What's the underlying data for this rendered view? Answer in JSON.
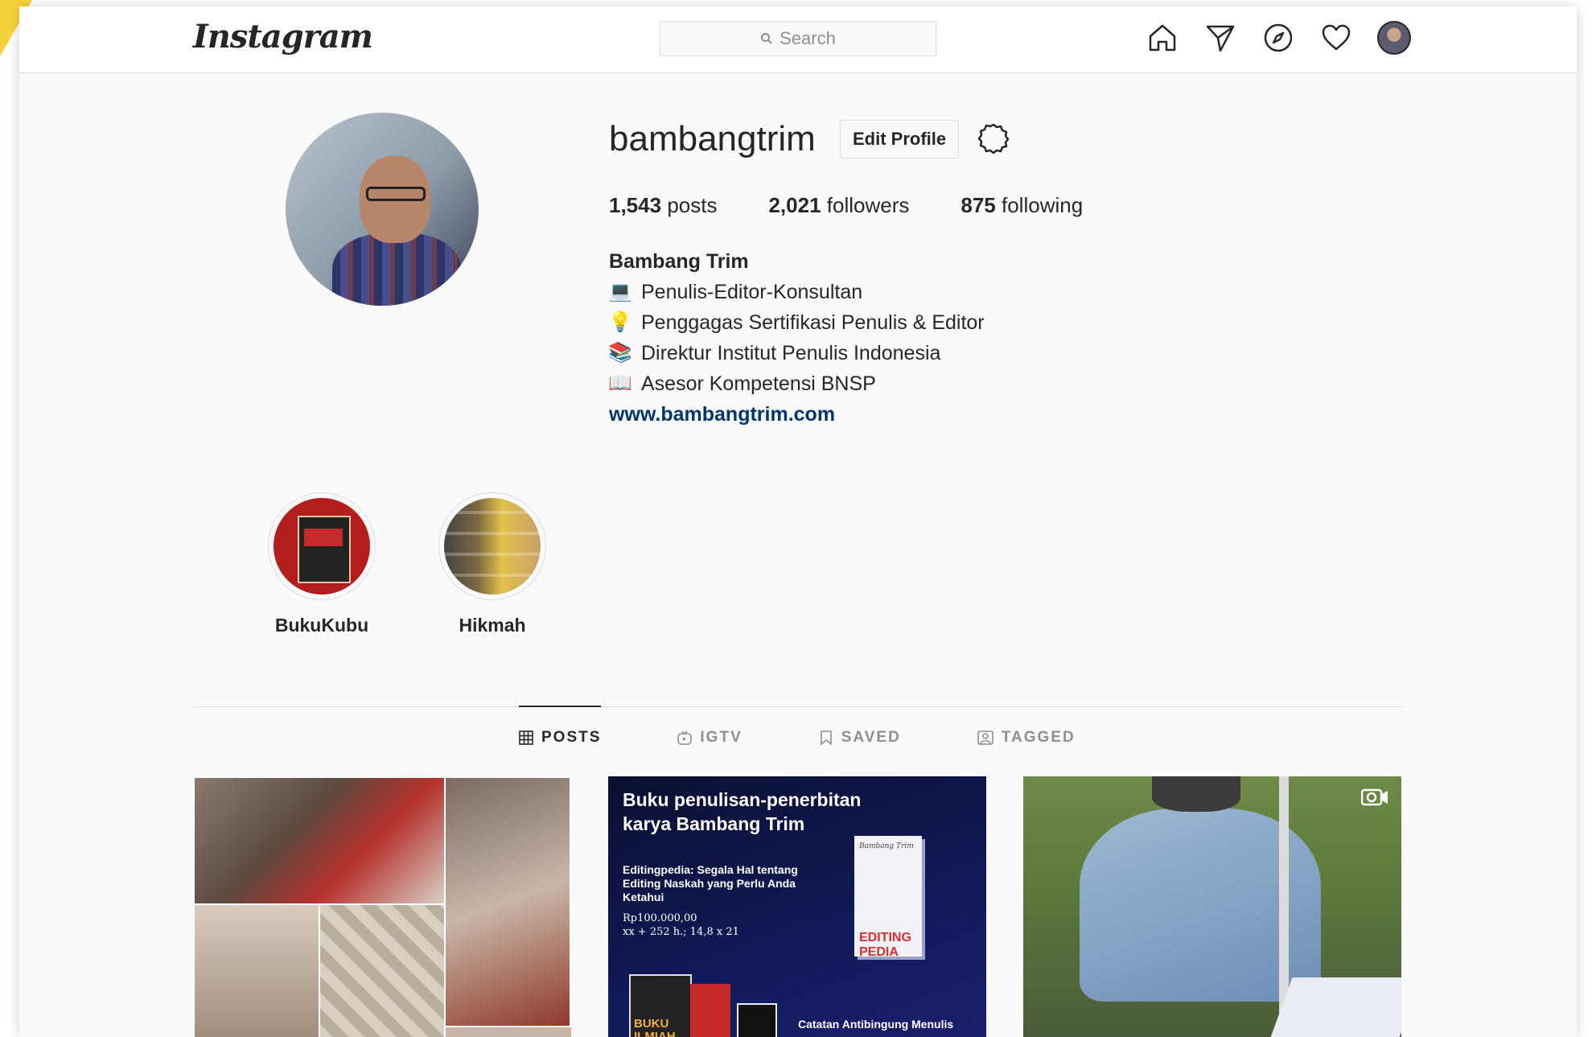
{
  "app": {
    "logo": "Instagram"
  },
  "search": {
    "placeholder": "Search"
  },
  "nav": {
    "icons": [
      "home-icon",
      "direct-icon",
      "explore-icon",
      "activity-heart-icon",
      "profile-avatar"
    ]
  },
  "profile": {
    "username": "bambangtrim",
    "edit_button": "Edit Profile",
    "stats": {
      "posts_count": "1,543",
      "posts_label": "posts",
      "followers_count": "2,021",
      "followers_label": "followers",
      "following_count": "875",
      "following_label": "following"
    },
    "bio": {
      "full_name": "Bambang Trim",
      "lines": [
        {
          "emoji": "💻",
          "text": "Penulis-Editor-Konsultan"
        },
        {
          "emoji": "💡",
          "text": "Penggagas Sertifikasi Penulis & Editor"
        },
        {
          "emoji": "📚",
          "text": "Direktur Institut Penulis Indonesia"
        },
        {
          "emoji": "📖",
          "text": "Asesor Kompetensi BNSP"
        }
      ],
      "website": "www.bambangtrim.com"
    }
  },
  "highlights": [
    {
      "label": "BukuKubu"
    },
    {
      "label": "Hikmah"
    }
  ],
  "tabs": [
    {
      "label": "POSTS",
      "active": true
    },
    {
      "label": "IGTV",
      "active": false
    },
    {
      "label": "SAVED",
      "active": false
    },
    {
      "label": "TAGGED",
      "active": false
    }
  ],
  "posts": [
    {
      "type": "image"
    },
    {
      "type": "image",
      "headline": "Buku penulisan-penerbitan\nkarya Bambang Trim",
      "book_title": "Editingpedia: Segala Hal tentang Editing Naskah yang Perlu Anda Ketahui",
      "price": "Rp100.000,00",
      "specs": "xx + 252 h.; 14,8 x 21",
      "cover_brand": "EDITING PEDIA",
      "cover_author": "Bambang Trim",
      "small_book": "BUKU ILMIAH",
      "footer": "Catatan Antibingung Menulis"
    },
    {
      "type": "video"
    }
  ],
  "colors": {
    "link": "#003569",
    "border": "#dbdbdb",
    "muted": "#8e8e8e",
    "text": "#262626"
  }
}
